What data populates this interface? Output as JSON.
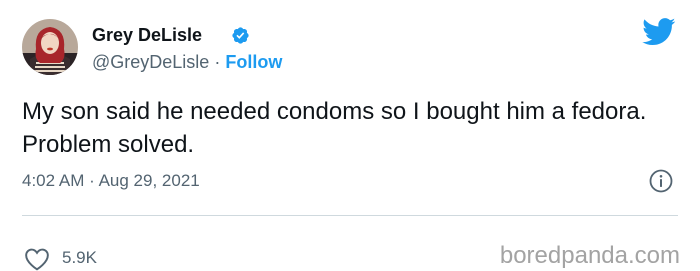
{
  "author": {
    "display_name": "Grey DeLisle",
    "handle": "@GreyDeLisle",
    "separator": "·",
    "follow_label": "Follow",
    "avatar_icon": "avatar-photo",
    "verified_icon": "verified-badge-icon"
  },
  "tweet": {
    "text": "My son said he needed condoms so I bought him a fedora. Problem solved.",
    "time": "4:02 AM",
    "separator": "·",
    "date": "Aug 29, 2021"
  },
  "engagement": {
    "like_icon": "heart-icon",
    "likes": "5.9K"
  },
  "watermark": {
    "text": "boredpanda.com"
  },
  "colors": {
    "accent": "#1d9bf0",
    "text_primary": "#0f1419",
    "text_secondary": "#536471",
    "divider": "#cfd9de"
  }
}
